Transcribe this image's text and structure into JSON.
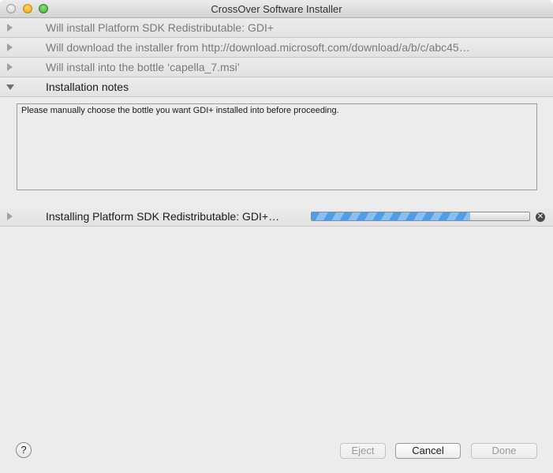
{
  "window": {
    "title": "CrossOver Software Installer"
  },
  "tasks": [
    {
      "label": "Will install Platform SDK Redistributable: GDI+",
      "expanded": false
    },
    {
      "label": "Will download the installer from http://download.microsoft.com/download/a/b/c/abc45…",
      "expanded": false
    },
    {
      "label": "Will install into the bottle ‘capella_7.msi’",
      "expanded": false
    },
    {
      "label": "Installation notes",
      "expanded": true
    }
  ],
  "notes": {
    "text": "Please manually choose the bottle you want GDI+ installed into before proceeding."
  },
  "installing": {
    "label": "Installing Platform SDK Redistributable: GDI+…",
    "progress_fraction": 0.73,
    "cancel_glyph": "✕"
  },
  "footer": {
    "help_glyph": "?",
    "eject_label": "Eject",
    "cancel_label": "Cancel",
    "done_label": "Done"
  }
}
